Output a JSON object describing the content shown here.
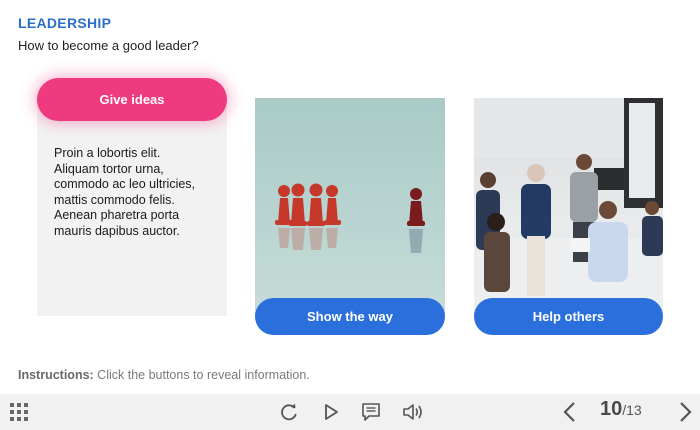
{
  "header": {
    "title": "LEADERSHIP",
    "subtitle": "How to become a good leader?"
  },
  "cards": [
    {
      "button_label": "Give ideas",
      "text_lines": [
        "Proin a lobortis elit.",
        "Aliquam tortor urna,",
        "commodo ac leo ultricies,",
        "mattis commodo felis.",
        "Aenean pharetra porta",
        "mauris dapibus auctor."
      ],
      "accent": "#ef3a7f"
    },
    {
      "button_label": "Show the way",
      "image": "red-pawns-leader-image",
      "accent": "#2b6fdd"
    },
    {
      "button_label": "Help others",
      "image": "team-meeting-photo",
      "accent": "#2b6fdd"
    }
  ],
  "instructions": {
    "label": "Instructions:",
    "text": " Click the buttons to reveal information."
  },
  "player": {
    "icons": [
      "menu-grid-icon",
      "replay-icon",
      "play-icon",
      "notes-icon",
      "audio-icon",
      "prev-icon",
      "next-icon"
    ],
    "current_page": "10",
    "total_pages": "/13"
  }
}
